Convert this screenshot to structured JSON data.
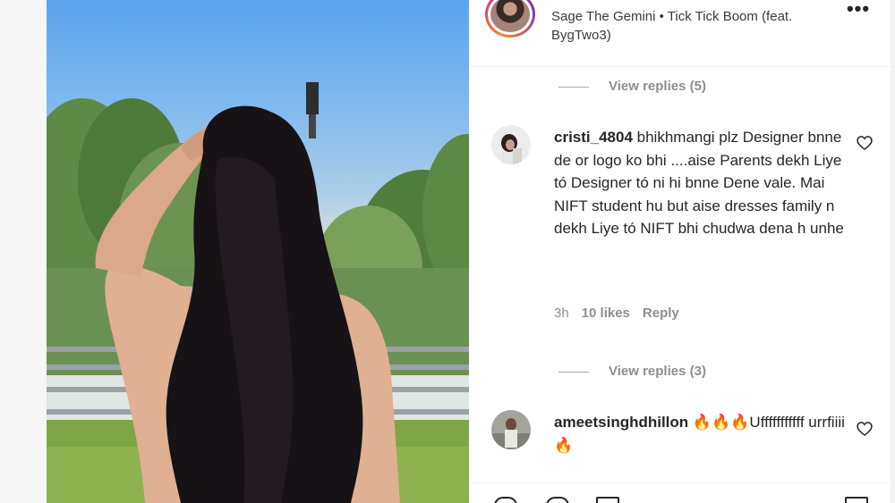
{
  "post": {
    "audio_line": "Sage The Gemini • Tick Tick Boom (feat. BygTwo3)",
    "more_icon": "more-horizontal-icon"
  },
  "comments": {
    "view_replies_1": "View replies (5)",
    "view_replies_2": "View replies (3)",
    "items": [
      {
        "username": "cristi_4804",
        "text": "bhikhmangi plz Designer bnne de or logo ko bhi ....aise Parents dekh Liye tó Designer tó ni hi bnne Dene vale. Mai NIFT student hu but aise dresses family n dekh Liye tó NIFT bhi chudwa dena h unhe",
        "time": "3h",
        "likes": "10 likes",
        "reply": "Reply"
      },
      {
        "username": "ameetsinghdhillon",
        "text": "🔥🔥🔥Ufffffffffff urrfiiii 🔥"
      }
    ]
  },
  "colors": {
    "text": "#262626",
    "secondary": "#8e8e8e",
    "divider": "#efefef"
  }
}
